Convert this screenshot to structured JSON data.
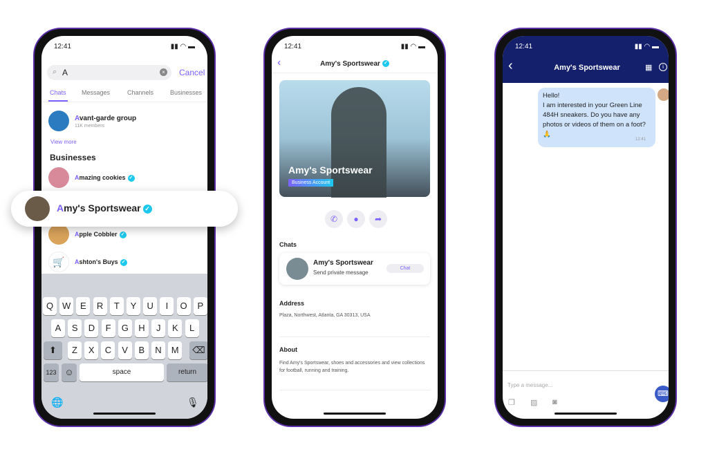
{
  "status_time": "12:41",
  "search": {
    "value": "A",
    "cancel": "Cancel",
    "tabs": [
      "Chats",
      "Messages",
      "Channels",
      "Businesses"
    ],
    "group": {
      "hl": "A",
      "name": "vant-garde group",
      "members": "11K members"
    },
    "view_more": "View more",
    "section": "Businesses",
    "results": [
      {
        "hl": "A",
        "name": "mazing cookies"
      },
      {
        "hl": "A",
        "name": "my's Sportswear"
      },
      {
        "hl": "A",
        "name": "pple Cobbler"
      },
      {
        "hl": "A",
        "name": "shton's Buys"
      }
    ]
  },
  "keyboard": {
    "row1": [
      "Q",
      "W",
      "E",
      "R",
      "T",
      "Y",
      "U",
      "I",
      "O",
      "P"
    ],
    "row2": [
      "A",
      "S",
      "D",
      "F",
      "G",
      "H",
      "J",
      "K",
      "L"
    ],
    "row3": [
      "Z",
      "X",
      "C",
      "V",
      "B",
      "N",
      "M"
    ],
    "numbers": "123",
    "space": "space",
    "return": "return"
  },
  "profile": {
    "title": "Amy's Sportswear",
    "hero_name": "Amy's Sportswear",
    "badge": "Business Account",
    "chats_label": "Chats",
    "chat_name": "Amy's Sportswear",
    "chat_sub": "Send private message",
    "chat_btn": "Chat",
    "address_label": "Address",
    "address": "Plaza, Northwest, Atlanta, GA 30313, USA",
    "about_label": "About",
    "about": "Find Amy's Sportswear, shoes and accessories and view collections for football, running and training."
  },
  "chat": {
    "title": "Amy's Sportswear",
    "message": "Hello!\nI am interested in your Green Line 484H sneakers. Do you have any photos or videos of them on a foot?🙏",
    "time": "12:41",
    "placeholder": "Type a message...",
    "header_color": "#14206b",
    "bubble_color": "#cfe3fb"
  },
  "accent": "#7b61ff"
}
